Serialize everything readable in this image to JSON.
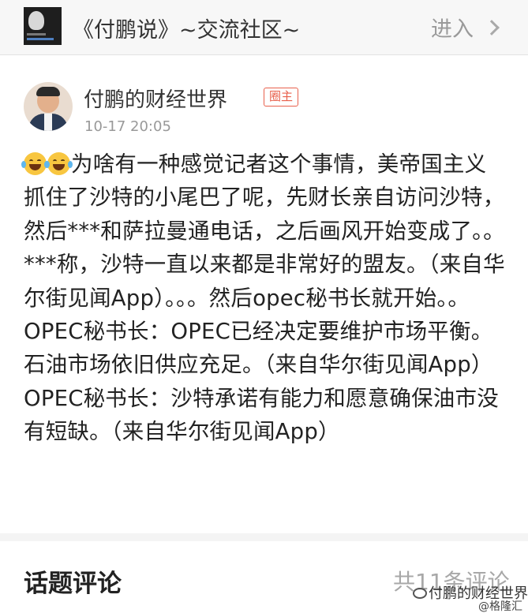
{
  "header": {
    "group_title": "《付鹏说》~交流社区~",
    "enter_label": "进入"
  },
  "post": {
    "author_name": "付鹏的财经世界",
    "role_badge": "圈主",
    "time": "10-17 20:05",
    "emoji": "joy-emoji",
    "body_text": "为啥有一种感觉记者这个事情，美帝国主义抓住了沙特的小尾巴了呢，先财长亲自访问沙特，然后***和萨拉曼通电话，之后画风开始变成了。。***称，沙特一直以来都是非常好的盟友。（来自华尔街见闻App）。。。然后opec秘书长就开始。。OPEC秘书长：OPEC已经决定要维护市场平衡。石油市场依旧供应充足。（来自华尔街见闻App）OPEC秘书长：沙特承诺有能力和愿意确保油市没有短缺。（来自华尔街见闻App）"
  },
  "comments": {
    "title": "话题评论",
    "count_text": "共11条评论"
  },
  "watermark": {
    "main": "付鹏的财经世界",
    "sub": "@格隆汇"
  }
}
